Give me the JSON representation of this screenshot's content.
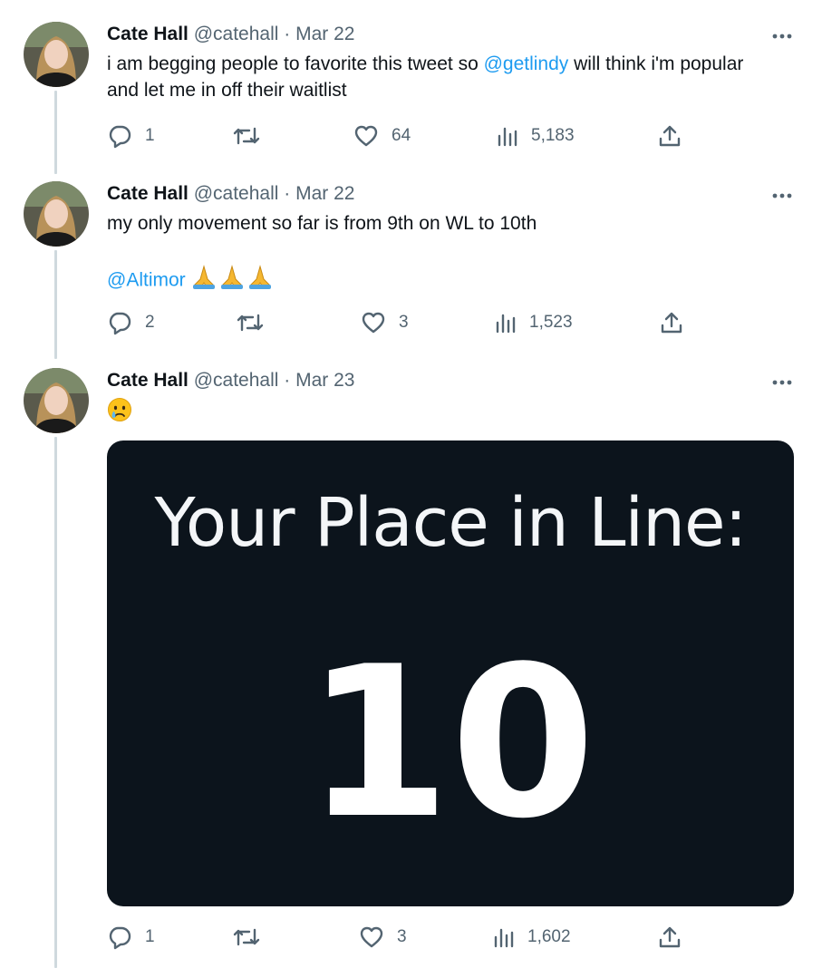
{
  "tweets": [
    {
      "author": {
        "name": "Cate Hall",
        "handle": "@catehall"
      },
      "separator": "·",
      "date": "Mar 22",
      "text_before": "i am begging people to favorite this tweet so ",
      "mention": "@getlindy",
      "text_after": " will think i'm popular and let me in off their waitlist",
      "stats": {
        "replies": "1",
        "retweets": "",
        "likes": "64",
        "views": "5,183"
      }
    },
    {
      "author": {
        "name": "Cate Hall",
        "handle": "@catehall"
      },
      "separator": "·",
      "date": "Mar 22",
      "text": "my only movement so far is from 9th on WL to 10th",
      "mention": "@Altimor",
      "emoji": [
        "folded-hands",
        "folded-hands",
        "folded-hands"
      ],
      "stats": {
        "replies": "2",
        "retweets": "",
        "likes": "3",
        "views": "1,523"
      }
    },
    {
      "author": {
        "name": "Cate Hall",
        "handle": "@catehall"
      },
      "separator": "·",
      "date": "Mar 23",
      "emoji": [
        "crying-face"
      ],
      "media": {
        "title": "Your Place in Line:",
        "number": "10"
      },
      "stats": {
        "replies": "1",
        "retweets": "",
        "likes": "3",
        "views": "1,602"
      }
    }
  ],
  "colors": {
    "accent": "#1d9bf0",
    "secondary_text": "#536471",
    "thread_line": "#cfd9de",
    "media_bg": "#0c141c"
  }
}
